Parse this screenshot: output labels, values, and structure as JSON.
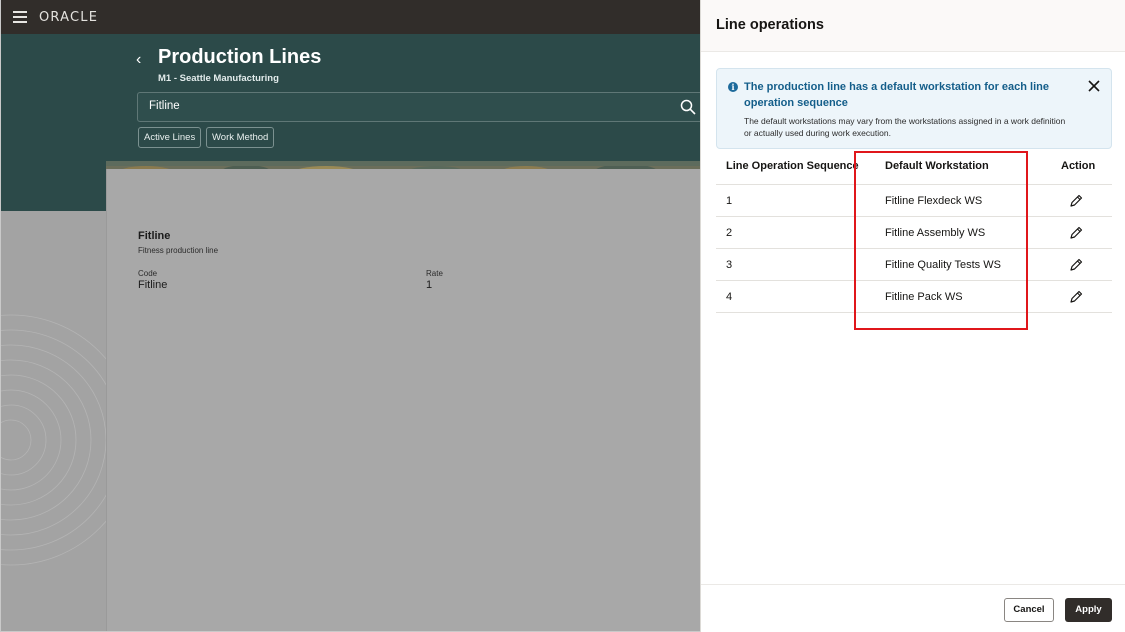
{
  "app": {
    "logo_text": "ORACLE"
  },
  "page": {
    "title": "Production Lines",
    "subtitle": "M1 - Seattle Manufacturing",
    "search_value": "Fitline",
    "filters": [
      "Active Lines",
      "Work Method"
    ]
  },
  "card": {
    "title": "Fitline",
    "description": "Fitness production line",
    "code_label": "Code",
    "code_value": "Fitline",
    "rate_label": "Rate",
    "rate_value": "1"
  },
  "drawer": {
    "title": "Line operations",
    "info": {
      "title": "The production line has a default workstation for each line operation sequence",
      "body": "The default workstations may vary from the workstations assigned in a work definition or actually used during work execution."
    },
    "columns": [
      "Line Operation Sequence",
      "Default Workstation",
      "Action"
    ],
    "rows": [
      {
        "sequence": "1",
        "workstation": "Fitline Flexdeck WS"
      },
      {
        "sequence": "2",
        "workstation": "Fitline Assembly WS"
      },
      {
        "sequence": "3",
        "workstation": "Fitline Quality Tests WS"
      },
      {
        "sequence": "4",
        "workstation": "Fitline Pack WS"
      }
    ],
    "cancel_label": "Cancel",
    "apply_label": "Apply"
  },
  "colors": {
    "header_bar": "#312d2a",
    "hero": "#2c4a49",
    "info_text": "#145e8a",
    "highlight": "#e0161b",
    "apply_button": "#312d2a"
  }
}
